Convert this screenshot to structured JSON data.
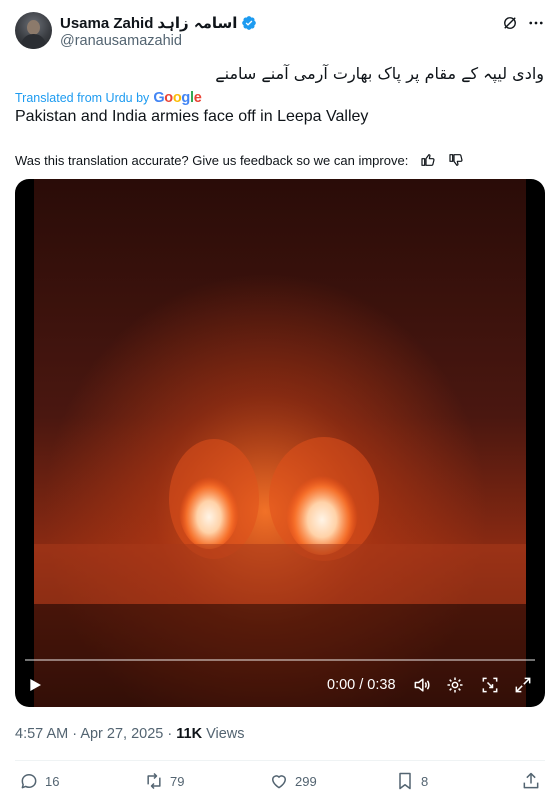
{
  "author": {
    "name": "Usama Zahid",
    "name_urdu": "اسامہ زاہد",
    "handle": "@ranausamazahid"
  },
  "post": {
    "text_urdu": "وادی لیپہ کے مقام پر پاک بھارت آرمی آمنے سامنے",
    "translated_prefix": "Translated from Urdu by",
    "translation": "Pakistan and India armies face off in Leepa Valley",
    "feedback_prompt": "Was this translation accurate? Give us feedback so we can improve:"
  },
  "video": {
    "time": "0:00 / 0:38",
    "progress": 0
  },
  "meta": {
    "time": "4:57 AM",
    "date": "Apr 27, 2025",
    "separator": "·",
    "views_count": "11K",
    "views_label": "Views"
  },
  "actions": {
    "replies": "16",
    "reposts": "79",
    "likes": "299",
    "bookmarks": "8"
  },
  "colors": {
    "accent": "#1d9bf0",
    "secondary_text": "#536471",
    "fire": "#ff6a1a"
  }
}
